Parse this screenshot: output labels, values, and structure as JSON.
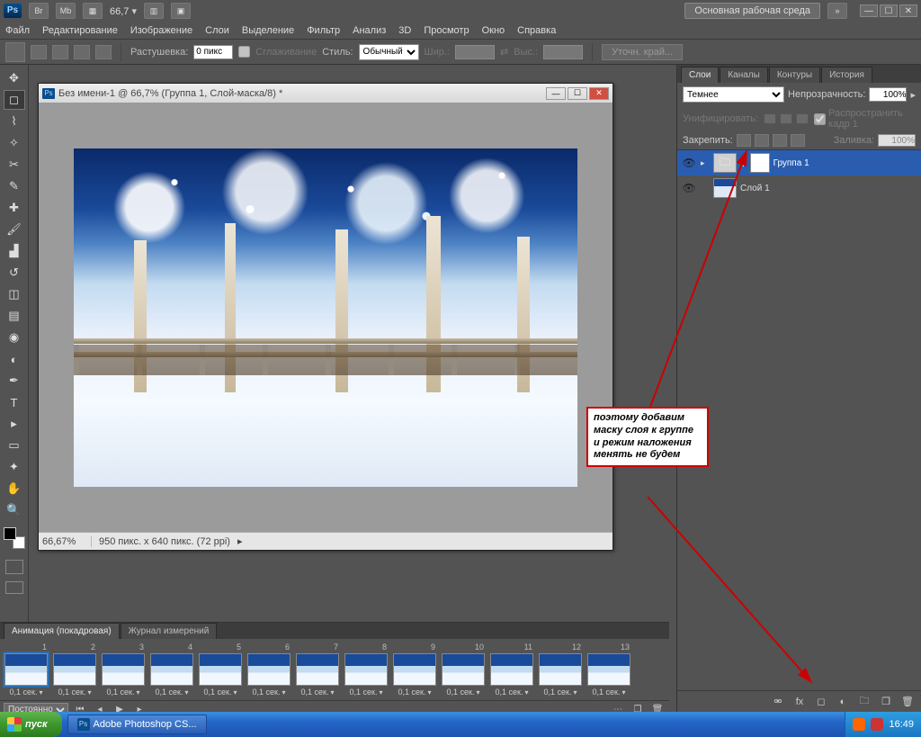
{
  "titlebar": {
    "quick": [
      "Br",
      "Mb"
    ],
    "zoom": "66,7",
    "workspace": "Основная рабочая среда"
  },
  "menu": [
    "Файл",
    "Редактирование",
    "Изображение",
    "Слои",
    "Выделение",
    "Фильтр",
    "Анализ",
    "3D",
    "Просмотр",
    "Окно",
    "Справка"
  ],
  "options": {
    "feather_label": "Растушевка:",
    "feather_value": "0 пикс",
    "antialias": "Сглаживание",
    "style_label": "Стиль:",
    "style_value": "Обычный",
    "width_label": "Шир.:",
    "height_label": "Выс.:",
    "refine": "Уточн. край..."
  },
  "document": {
    "title": "Без имени-1 @ 66,7% (Группа 1, Слой-маска/8) *",
    "zoom": "66,67%",
    "dims": "950 пикс. x 640 пикс. (72 ppi)"
  },
  "layers_panel": {
    "tabs": [
      "Слои",
      "Каналы",
      "Контуры",
      "История"
    ],
    "blend_mode": "Темнее",
    "opacity_label": "Непрозрачность:",
    "opacity": "100%",
    "unify_label": "Унифицировать:",
    "propagate": "Распространить кадр 1",
    "lock_label": "Закрепить:",
    "fill_label": "Заливка:",
    "fill": "100%",
    "layers": [
      {
        "name": "Группа 1",
        "type": "group",
        "selected": true,
        "mask": true
      },
      {
        "name": "Слой 1",
        "type": "image",
        "selected": false,
        "mask": false
      }
    ]
  },
  "annotation": "поэтому добавим маску слоя к группе и режим наложения менять не будем",
  "timeline": {
    "tabs": [
      "Анимация (покадровая)",
      "Журнал измерений"
    ],
    "frame_count": 13,
    "delay": "0,1 сек.",
    "loop": "Постоянно"
  },
  "taskbar": {
    "start": "пуск",
    "task": "Adobe Photoshop CS...",
    "time": "16:49"
  }
}
